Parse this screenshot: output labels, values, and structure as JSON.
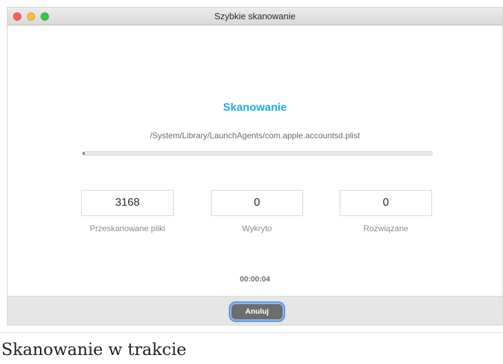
{
  "window": {
    "title": "Szybkie skanowanie"
  },
  "scan": {
    "heading": "Skanowanie",
    "current_path": "/System/Library/LaunchAgents/com.apple.accountsd.plist",
    "progress_fraction": 0.005,
    "elapsed": "00:00:04"
  },
  "stats": [
    {
      "value": "3168",
      "label": "Przeskanowane pliki"
    },
    {
      "value": "0",
      "label": "Wykryto"
    },
    {
      "value": "0",
      "label": "Rozwiązane"
    }
  ],
  "footer": {
    "cancel_label": "Anuluj"
  },
  "caption": "Skanowanie w trakcie",
  "colors": {
    "accent": "#1fa9f2",
    "progress": "#3b82e6",
    "close": "#fc605c",
    "minimize": "#fdbc40",
    "maximize": "#34c84a"
  }
}
